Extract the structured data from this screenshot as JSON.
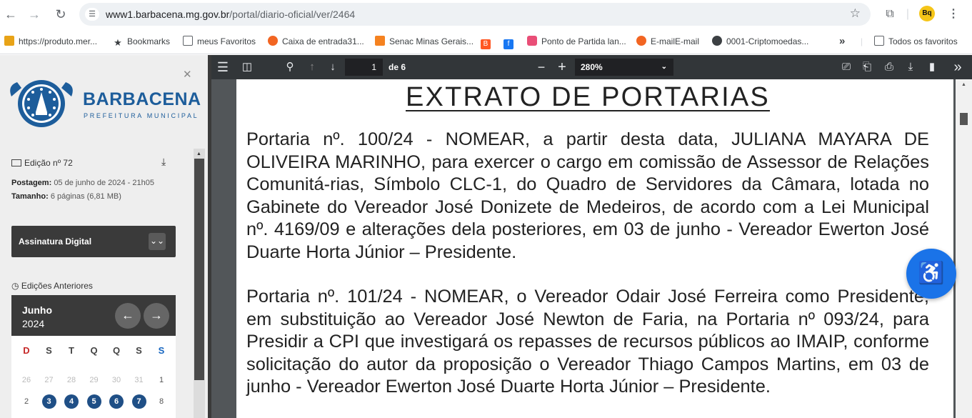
{
  "browser": {
    "url_domain": "www1.barbacena.mg.gov.br",
    "url_path": "/portal/diario-oficial/ver/2464",
    "profile_initials": "Bq"
  },
  "bookmarks": [
    {
      "label": "https://produto.mer...",
      "icon": "handshake-icon",
      "color": "#e8a317"
    },
    {
      "label": "Bookmarks",
      "icon": "star-icon",
      "color": "#3c4043"
    },
    {
      "label": "meus Favoritos",
      "icon": "folder-icon",
      "color": "#5f6368"
    },
    {
      "label": "Caixa de entrada31...",
      "icon": "mail-icon",
      "color": "#f26522"
    },
    {
      "label": "Senac Minas Gerais...",
      "icon": "senac-icon",
      "color": "#f58220"
    },
    {
      "label": "",
      "icon": "blogger-icon",
      "color": "#ff5722"
    },
    {
      "label": "",
      "icon": "facebook-icon",
      "color": "#1877f2"
    },
    {
      "label": "Ponto de Partida lan...",
      "icon": "puzzle-icon",
      "color": "#e94e77"
    },
    {
      "label": "E-mailE-mail",
      "icon": "mail-icon",
      "color": "#f26522"
    },
    {
      "label": "0001-Criptomoedas...",
      "icon": "globe-icon",
      "color": "#3c4043"
    },
    {
      "label": "Todos os favoritos",
      "icon": "folder-icon",
      "color": "#5f6368"
    }
  ],
  "sidebar": {
    "brand_title": "BARBACENA",
    "brand_subtitle": "PREFEITURA MUNICIPAL",
    "edition_label": "Edição nº 72",
    "posted_label": "Postagem:",
    "posted_value": "05 de junho de 2024 - 21h05",
    "size_label": "Tamanho:",
    "size_value": "6 páginas (6,81 MB)",
    "signature_label": "Assinatura Digital",
    "previous_label": "Edições Anteriores",
    "calendar": {
      "month": "Junho",
      "year": "2024",
      "weekdays": [
        "D",
        "S",
        "T",
        "Q",
        "Q",
        "S",
        "S"
      ],
      "weekday_colors": [
        "#c62828",
        "#444444",
        "#444444",
        "#444444",
        "#444444",
        "#444444",
        "#1565c0"
      ],
      "week1": [
        {
          "d": "26",
          "type": "muted"
        },
        {
          "d": "27",
          "type": "muted"
        },
        {
          "d": "28",
          "type": "muted"
        },
        {
          "d": "29",
          "type": "muted"
        },
        {
          "d": "30",
          "type": "muted"
        },
        {
          "d": "31",
          "type": "muted"
        },
        {
          "d": "1",
          "type": "normal"
        }
      ],
      "week2": [
        {
          "d": "2",
          "type": "normal"
        },
        {
          "d": "3",
          "type": "pub"
        },
        {
          "d": "4",
          "type": "pub"
        },
        {
          "d": "5",
          "type": "pub"
        },
        {
          "d": "6",
          "type": "pub"
        },
        {
          "d": "7",
          "type": "pub"
        },
        {
          "d": "8",
          "type": "normal"
        }
      ]
    }
  },
  "pdf": {
    "current_page": "1",
    "page_total": "de 6",
    "zoom": "280%",
    "title": "EXTRATO DE PORTARIAS",
    "paragraphs": [
      "Portaria nº. 100/24 - NOMEAR, a partir desta data, JULIANA MAYARA DE OLIVEIRA MARINHO, para exercer o cargo em comissão de Assessor de Relações Comunitá-rias, Símbolo CLC-1, do Quadro de Servidores da Câmara, lotada no Gabinete do Vereador José Donizete de Medeiros, de acordo com a Lei Municipal nº. 4169/09 e alterações dela posteriores, em 03 de junho - Vereador Ewerton José Duarte Horta Júnior – Presidente.",
      "Portaria nº. 101/24 - NOMEAR, o Vereador Odair José Ferreira como Presidente, em substituição ao Vereador José Newton de Faria, na Portaria nº 093/24, para Presidir a CPI que investigará os repasses de recursos públicos ao IMAIP, conforme solicitação do autor da proposição o Vereador Thiago Campos Martins, em  03 de junho - Vereador Ewerton José Duarte Horta Júnior – Presidente."
    ]
  }
}
